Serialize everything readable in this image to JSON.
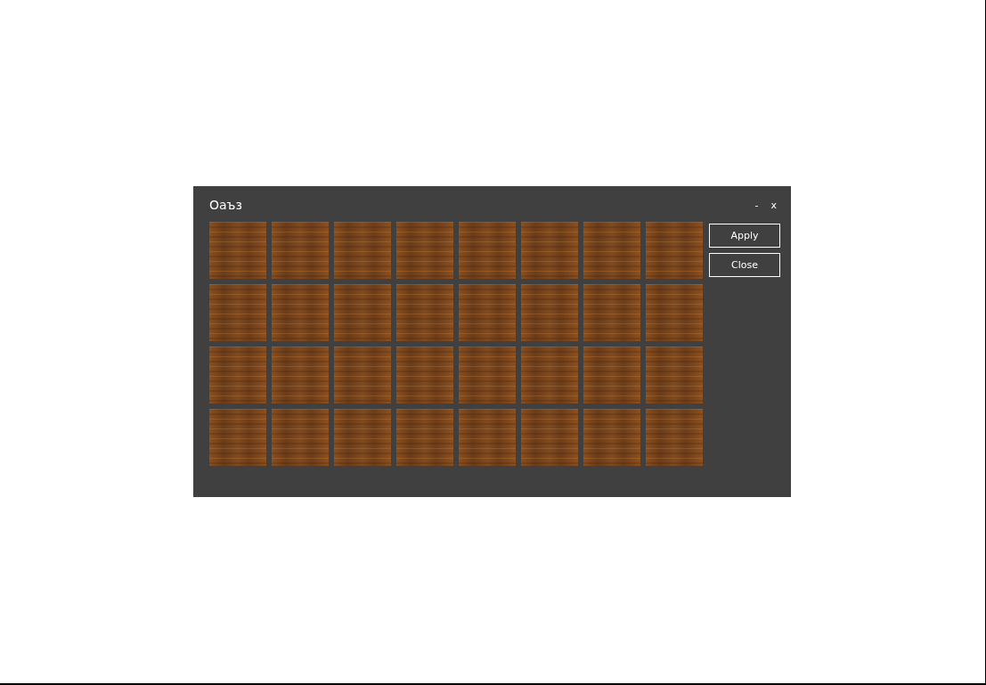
{
  "window": {
    "title": "Оаъз",
    "controls": [
      "-",
      "x"
    ]
  },
  "tile_rows": [
    [
      {
        "kind": "wood"
      },
      {
        "kind": "wood"
      },
      {
        "kind": "wood"
      },
      {
        "kind": "wood"
      },
      {
        "kind": "wood"
      },
      {
        "kind": "wood"
      },
      {
        "kind": "wood"
      },
      {
        "kind": "wood"
      }
    ],
    [
      {
        "kind": "wood"
      },
      {
        "kind": "wood"
      },
      {
        "kind": "wood"
      },
      {
        "kind": "wood"
      },
      {
        "kind": "wood"
      },
      {
        "kind": "wood"
      },
      {
        "kind": "wood"
      },
      {
        "kind": "wood"
      }
    ],
    [
      {
        "kind": "wood"
      },
      {
        "kind": "wood"
      },
      {
        "kind": "wood"
      },
      {
        "kind": "wood"
      },
      {
        "kind": "wood"
      },
      {
        "kind": "wood"
      },
      {
        "kind": "wood"
      },
      {
        "kind": "wood"
      }
    ],
    [
      {
        "kind": "wood"
      },
      {
        "kind": "wood"
      },
      {
        "kind": "wood"
      },
      {
        "kind": "wood"
      },
      {
        "kind": "wood"
      },
      {
        "kind": "wood"
      },
      {
        "kind": "wood"
      },
      {
        "kind": "wood"
      }
    ]
  ],
  "buttons": [
    "Apply",
    "Close"
  ]
}
